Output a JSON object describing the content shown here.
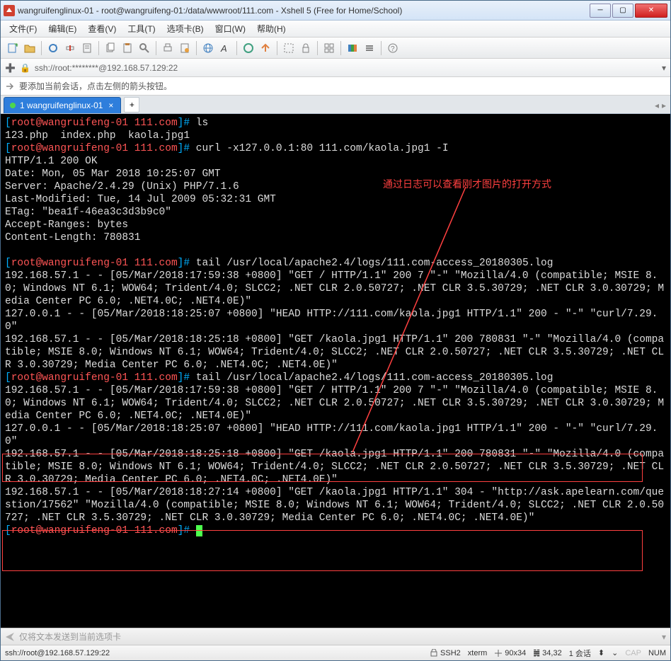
{
  "window": {
    "title": "wangruifenglinux-01 - root@wangruifeng-01:/data/wwwroot/111.com - Xshell 5 (Free for Home/School)"
  },
  "menu": {
    "file": "文件(F)",
    "edit": "编辑(E)",
    "view": "查看(V)",
    "tools": "工具(T)",
    "options": "选项卡(B)",
    "window": "窗口(W)",
    "help": "帮助(H)"
  },
  "address": {
    "text": "ssh://root:********@192.168.57.129:22"
  },
  "tip": {
    "text": "要添加当前会话，点击左侧的箭头按钮。"
  },
  "tab": {
    "label": "1 wangruifenglinux-01"
  },
  "annotation": {
    "text": "通过日志可以查看刚才图片的打开方式"
  },
  "terminal": {
    "prompt": "[root@wangruifeng-01 111.com]#",
    "p_open": "[",
    "p_body": "root@wangruifeng-01 111.com",
    "p_close": "]#",
    "cmd1": "ls",
    "out1": "123.php  index.php  kaola.jpg1",
    "cmd2": "curl -x127.0.0.1:80 111.com/kaola.jpg1 -I",
    "out2": "HTTP/1.1 200 OK\nDate: Mon, 05 Mar 2018 10:25:07 GMT\nServer: Apache/2.4.29 (Unix) PHP/7.1.6\nLast-Modified: Tue, 14 Jul 2009 05:32:31 GMT\nETag: \"bea1f-46ea3c3d3b9c0\"\nAccept-Ranges: bytes\nContent-Length: 780831\n",
    "cmd3": "tail /usr/local/apache2.4/logs/111.com-access_20180305.log",
    "out3": "192.168.57.1 - - [05/Mar/2018:17:59:38 +0800] \"GET / HTTP/1.1\" 200 7 \"-\" \"Mozilla/4.0 (compatible; MSIE 8.0; Windows NT 6.1; WOW64; Trident/4.0; SLCC2; .NET CLR 2.0.50727; .NET CLR 3.5.30729; .NET CLR 3.0.30729; Media Center PC 6.0; .NET4.0C; .NET4.0E)\"\n127.0.0.1 - - [05/Mar/2018:18:25:07 +0800] \"HEAD HTTP://111.com/kaola.jpg1 HTTP/1.1\" 200 - \"-\" \"curl/7.29.0\"\n192.168.57.1 - - [05/Mar/2018:18:25:18 +0800] \"GET /kaola.jpg1 HTTP/1.1\" 200 780831 \"-\" \"Mozilla/4.0 (compatible; MSIE 8.0; Windows NT 6.1; WOW64; Trident/4.0; SLCC2; .NET CLR 2.0.50727; .NET CLR 3.5.30729; .NET CLR 3.0.30729; Media Center PC 6.0; .NET4.0C; .NET4.0E)\"",
    "cmd4": "tail /usr/local/apache2.4/logs/111.com-access_20180305.log",
    "out4a": "192.168.57.1 - - [05/Mar/2018:17:59:38 +0800] \"GET / HTTP/1.1\" 200 7 \"-\" \"Mozilla/4.0 (compatible; MSIE 8.0; Windows NT 6.1; WOW64; Trident/4.0; SLCC2; .NET CLR 2.0.50727; .NET CLR 3.5.30729; .NET CLR 3.0.30729; Media Center PC 6.0; .NET4.0C; .NET4.0E)\"",
    "out4b": "127.0.0.1 - - [05/Mar/2018:18:25:07 +0800] \"HEAD HTTP://111.com/kaola.jpg1 HTTP/1.1\" 200 - \"-\" \"curl/7.29.0\"",
    "out4c": "192.168.57.1 - - [05/Mar/2018:18:25:18 +0800] \"GET /kaola.jpg1 HTTP/1.1\" 200 780831 \"-\" \"Mozilla/4.0 (compatible; MSIE 8.0; Windows NT 6.1; WOW64; Trident/4.0; SLCC2; .NET CLR 2.0.50727; .NET CLR 3.5.30729; .NET CLR 3.0.30729; Media Center PC 6.0; .NET4.0C; .NET4.0E)\"",
    "out4d": "192.168.57.1 - - [05/Mar/2018:18:27:14 +0800] \"GET /kaola.jpg1 HTTP/1.1\" 304 - \"http://ask.apelearn.com/question/17562\" \"Mozilla/4.0 (compatible; MSIE 8.0; Windows NT 6.1; WOW64; Trident/4.0; SLCC2; .NET CLR 2.0.50727; .NET CLR 3.5.30729; .NET CLR 3.0.30729; Media Center PC 6.0; .NET4.0C; .NET4.0E)\""
  },
  "footer": {
    "text": "仅将文本发送到当前选项卡"
  },
  "status": {
    "left": "ssh://root@192.168.57.129:22",
    "ssh": "SSH2",
    "term": "xterm",
    "size": "90x34",
    "pos": "34,32",
    "sess": "1 会话",
    "cap": "CAP",
    "num": "NUM"
  }
}
